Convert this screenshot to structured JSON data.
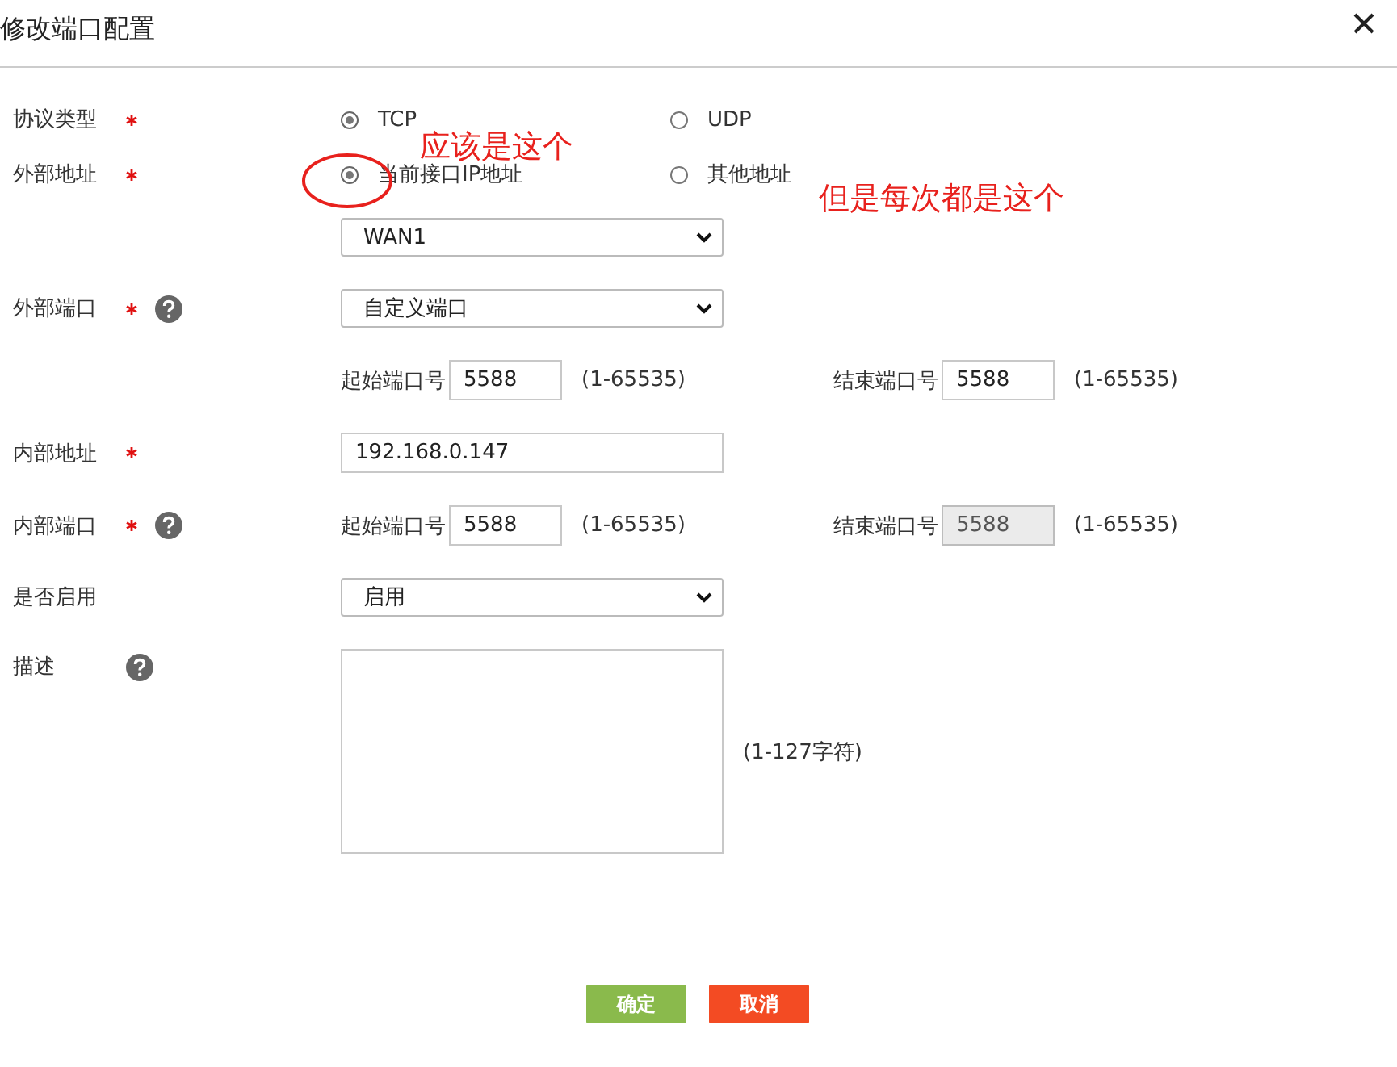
{
  "dialog": {
    "title": "修改端口配置"
  },
  "rows": [
    {
      "kind": "radio",
      "label": "协议类型",
      "required": true,
      "help": false,
      "options": [
        {
          "label": "TCP",
          "selected": true
        },
        {
          "label": "UDP",
          "selected": false
        }
      ]
    },
    {
      "kind": "radio",
      "label": "外部地址",
      "required": true,
      "help": false,
      "options": [
        {
          "label": "当前接口IP地址",
          "selected": true
        },
        {
          "label": "其他地址",
          "selected": false
        }
      ]
    },
    {
      "kind": "select",
      "value": "WAN1"
    },
    {
      "kind": "select",
      "label": "外部端口",
      "required": true,
      "help": true,
      "value": "自定义端口"
    },
    {
      "kind": "range",
      "start": {
        "label": "起始端口号",
        "value": "5588",
        "range": "(1-65535)",
        "disabled": false
      },
      "end": {
        "label": "结束端口号",
        "value": "5588",
        "range": "(1-65535)",
        "disabled": false
      }
    },
    {
      "kind": "text",
      "label": "内部地址",
      "required": true,
      "help": false,
      "value": "192.168.0.147"
    },
    {
      "kind": "range",
      "label": "内部端口",
      "required": true,
      "help": true,
      "start": {
        "label": "起始端口号",
        "value": "5588",
        "range": "(1-65535)",
        "disabled": false
      },
      "end": {
        "label": "结束端口号",
        "value": "5588",
        "range": "(1-65535)",
        "disabled": true
      }
    },
    {
      "kind": "select",
      "label": "是否启用",
      "required": false,
      "help": false,
      "value": "启用"
    },
    {
      "kind": "textarea",
      "label": "描述",
      "required": false,
      "help": true,
      "hint": "(1-127字符)"
    }
  ],
  "annotations": [
    {
      "text": "应该是这个",
      "circle": true
    },
    {
      "text": "但是每次都是这个",
      "circle": false
    }
  ],
  "buttons": [
    {
      "label": "确定",
      "kind": "ok"
    },
    {
      "label": "取消",
      "kind": "cancel"
    }
  ]
}
